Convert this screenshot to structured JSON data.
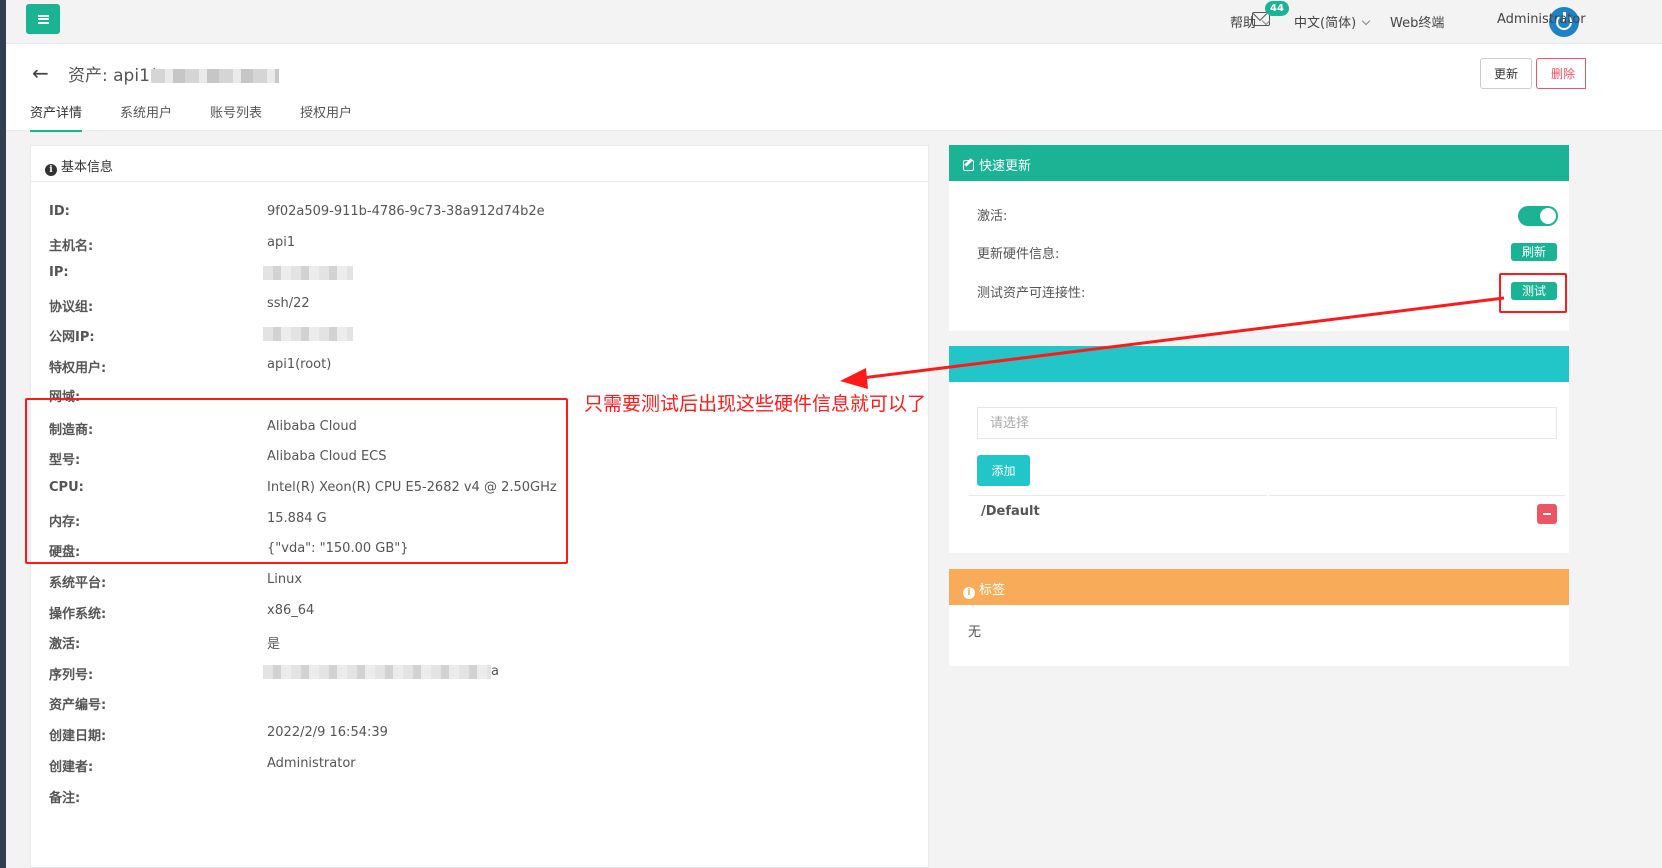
{
  "topnav": {
    "mail_badge": "44",
    "help": "帮助",
    "language": "中文(简体)",
    "web_terminal": "Web终端",
    "user": "Administrator"
  },
  "header": {
    "back_icon": "←",
    "title": "资产: api1(",
    "tabs": [
      "资产详情",
      "系统用户",
      "账号列表",
      "授权用户"
    ],
    "update_label": "更新",
    "delete_label": "删除"
  },
  "basic": {
    "title": "基本信息",
    "fields": [
      {
        "label": "ID:",
        "value": "9f02a509-911b-4786-9c73-38a912d74b2e"
      },
      {
        "label": "主机名:",
        "value": "api1"
      },
      {
        "label": "IP:",
        "value": ""
      },
      {
        "label": "协议组:",
        "value": "ssh/22"
      },
      {
        "label": "公网IP:",
        "value": ""
      },
      {
        "label": "特权用户:",
        "value": "api1(root)"
      },
      {
        "label": "网域:",
        "value": ""
      },
      {
        "label": "制造商:",
        "value": "Alibaba Cloud"
      },
      {
        "label": "型号:",
        "value": "Alibaba Cloud ECS"
      },
      {
        "label": "CPU:",
        "value": "Intel(R) Xeon(R) CPU E5-2682 v4 @ 2.50GHz"
      },
      {
        "label": "内存:",
        "value": "15.884 G"
      },
      {
        "label": "硬盘:",
        "value": "{\"vda\": \"150.00 GB\"}"
      },
      {
        "label": "系统平台:",
        "value": "Linux"
      },
      {
        "label": "操作系统:",
        "value": "x86_64"
      },
      {
        "label": "激活:",
        "value": "是"
      },
      {
        "label": "序列号:",
        "value": "a"
      },
      {
        "label": "资产编号:",
        "value": ""
      },
      {
        "label": "创建日期:",
        "value": "2022/2/9 16:54:39"
      },
      {
        "label": "创建者:",
        "value": "Administrator"
      },
      {
        "label": "备注:",
        "value": ""
      }
    ]
  },
  "quick": {
    "title": "快速更新",
    "active_label": "激活:",
    "active_on": true,
    "hardware_label": "更新硬件信息:",
    "refresh_label": "刷新",
    "test_label": "测试资产可连接性:",
    "test_button": "测试"
  },
  "node": {
    "placeholder": "请选择",
    "add_label": "添加",
    "items": [
      "/Default"
    ]
  },
  "tags": {
    "title": "标签",
    "empty": "无"
  },
  "annotation": {
    "text": "只需要测试后出现这些硬件信息就可以了"
  },
  "colors": {
    "primary": "#1ab394",
    "info": "#23c6c8",
    "warning": "#f8ac59",
    "danger": "#ed5565",
    "annotation_red": "#ff1a1a"
  }
}
